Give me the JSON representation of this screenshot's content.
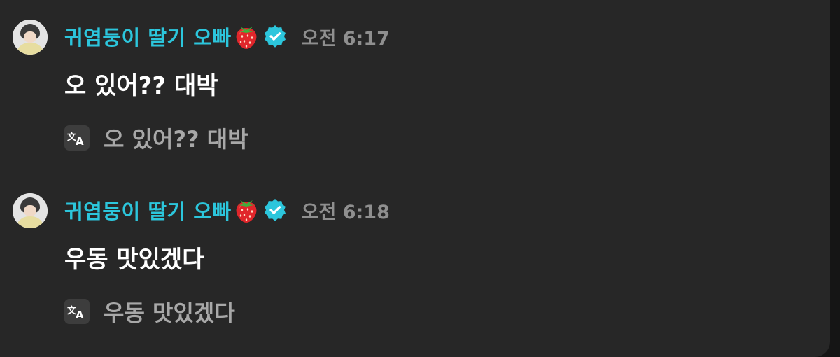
{
  "messages": [
    {
      "username": "귀염둥이 딸기 오빠",
      "name_emoji": "strawberry-icon",
      "verified_icon": "verified-badge-icon",
      "time": "오전 6:17",
      "text": "오 있어?? 대박",
      "translation_icon": "translate-icon",
      "translation": "오 있어?? 대박"
    },
    {
      "username": "귀염둥이 딸기 오빠",
      "name_emoji": "strawberry-icon",
      "verified_icon": "verified-badge-icon",
      "time": "오전 6:18",
      "text": "우동 맛있겠다",
      "translation_icon": "translate-icon",
      "translation": "우동 맛있겠다"
    }
  ],
  "colors": {
    "username": "#2cc6dc",
    "verified_badge": "#2cc6dc",
    "timestamp": "#8f8f8f",
    "message_text": "#ffffff",
    "translation_text": "#a8a8a8",
    "background": "#272727"
  }
}
